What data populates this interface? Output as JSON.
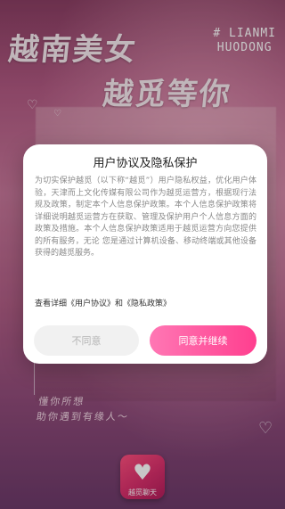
{
  "background": {
    "hero_title_1": "越南美女",
    "hero_title_2": "越觅等你",
    "hashtag_line_1": "# LIANMI",
    "hashtag_line_2": "HUODONG",
    "tagline_1": "懂你所想",
    "tagline_2": "助你遇到有缘人～",
    "accent_color": "#ff3f8f"
  },
  "app_icon": {
    "glyph": "♥",
    "label": "越觅聊天"
  },
  "dialog": {
    "title": "用户协议及隐私保护",
    "body": "为切实保护越觅（以下称“越觅”）用户隐私权益，优化用户体验，天津而上文化传媒有限公司作为越觅运营方，根据现行法规及政策，制定本个人信息保护政策。本个人信息保护政策将详细说明越觅运营方在获取、管理及保护用户个人信息方面的政策及措施。本个人信息保护政策适用于越觅运营方向您提供的所有服务，无论 您是通过计算机设备、移动终端或其他设备获得的越觅服务。",
    "links_text": "查看详细《用户协议》和《隐私政策》",
    "disagree_label": "不同意",
    "agree_label": "同意并继续"
  },
  "decor": {
    "heart_icon": "♡"
  }
}
